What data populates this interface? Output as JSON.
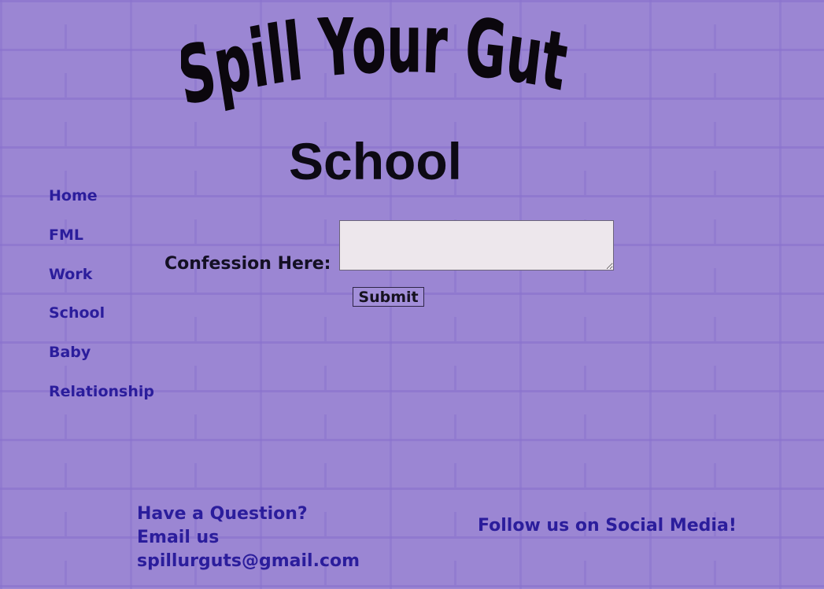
{
  "logo": {
    "text": "Spill Your Guts!"
  },
  "page": {
    "title": "School"
  },
  "nav": [
    {
      "label": "Home"
    },
    {
      "label": "FML"
    },
    {
      "label": "Work"
    },
    {
      "label": "School"
    },
    {
      "label": "Baby"
    },
    {
      "label": "Relationship"
    }
  ],
  "form": {
    "label": "Confession Here:",
    "value": "",
    "submit_label": "Submit"
  },
  "footer": {
    "question": "Have a Question?",
    "email_prompt": "Email us",
    "email": "spillurguts@gmail.com",
    "social": "Follow us on Social Media!"
  },
  "colors": {
    "background": "#9d88d5",
    "nav_link": "#2b1d9c",
    "input_bg": "#ede7ec"
  }
}
